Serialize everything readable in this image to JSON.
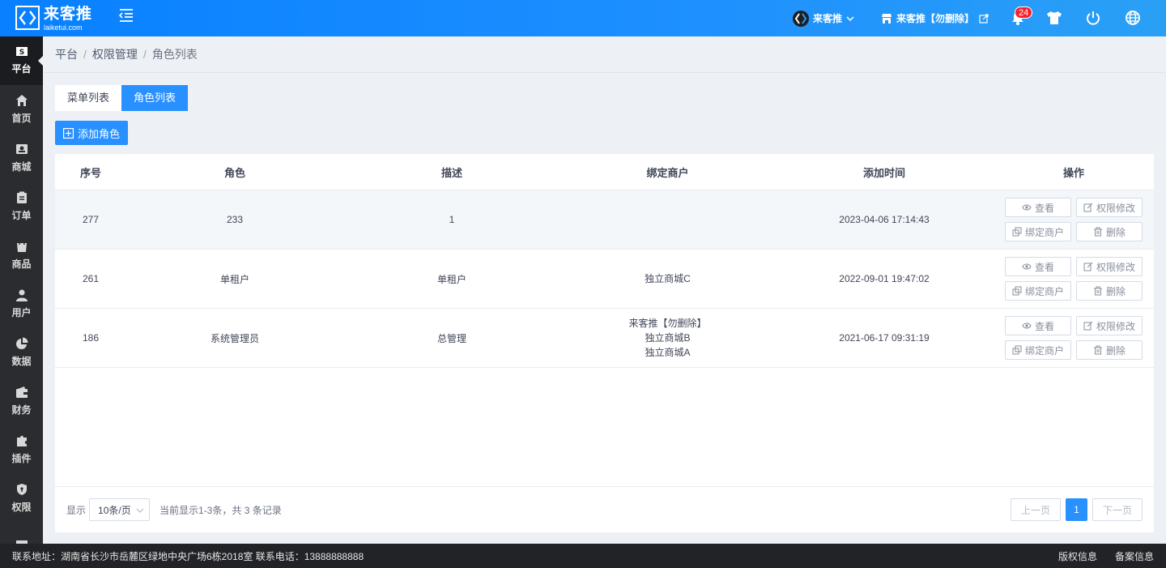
{
  "header": {
    "logo_text": "来客推",
    "logo_sub": "laiketui.com",
    "store_label": "来客推",
    "shop_label": "来客推【勿删除】",
    "notify_count": "24"
  },
  "sidebar": {
    "items": [
      {
        "label": "平台",
        "icon": "platform-icon"
      },
      {
        "label": "首页",
        "icon": "home-icon"
      },
      {
        "label": "商城",
        "icon": "mall-icon"
      },
      {
        "label": "订单",
        "icon": "order-icon"
      },
      {
        "label": "商品",
        "icon": "goods-icon"
      },
      {
        "label": "用户",
        "icon": "user-icon"
      },
      {
        "label": "数据",
        "icon": "chart-pie-icon"
      },
      {
        "label": "财务",
        "icon": "wallet-icon"
      },
      {
        "label": "插件",
        "icon": "puzzle-icon"
      },
      {
        "label": "权限",
        "icon": "shield-icon"
      },
      {
        "label": "",
        "icon": "image-icon"
      }
    ]
  },
  "breadcrumb": [
    "平台",
    "权限管理",
    "角色列表"
  ],
  "tabs": [
    "菜单列表",
    "角色列表"
  ],
  "add_button": "添加角色",
  "table": {
    "headers": [
      "序号",
      "角色",
      "描述",
      "绑定商户",
      "添加时间",
      "操作"
    ],
    "rows": [
      {
        "id": "277",
        "role": "233",
        "desc": "1",
        "bind": [
          "",
          "",
          ""
        ],
        "time": "2023-04-06 17:14:43"
      },
      {
        "id": "261",
        "role": "单租户",
        "desc": "单租户",
        "bind": [
          "独立商城C",
          "",
          ""
        ],
        "time": "2022-09-01 19:47:02"
      },
      {
        "id": "186",
        "role": "系统管理员",
        "desc": "总管理",
        "bind": [
          "来客推【勿删除】",
          "独立商城B",
          "独立商城A"
        ],
        "time": "2021-06-17 09:31:19"
      }
    ],
    "actions": {
      "view": "查看",
      "edit_perm": "权限修改",
      "bind_merchant": "绑定商户",
      "delete": "删除"
    }
  },
  "pager": {
    "show_label": "显示",
    "page_size": "10条/页",
    "summary": "当前显示1-3条，共 3 条记录",
    "prev": "上一页",
    "current": "1",
    "next": "下一页"
  },
  "footer": {
    "address": "联系地址：湖南省长沙市岳麓区绿地中央广场6栋2018室 联系电话：13888888888",
    "copyright": "版权信息",
    "record": "备案信息"
  },
  "colors": {
    "primary": "#2890ff",
    "sidebar": "#2b2c30",
    "badge": "#f5222d"
  }
}
